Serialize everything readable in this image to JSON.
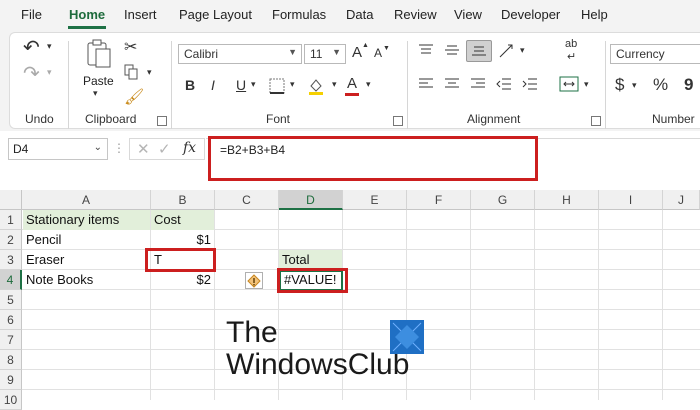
{
  "menu": {
    "items": [
      "File",
      "Home",
      "Insert",
      "Page Layout",
      "Formulas",
      "Data",
      "Review",
      "View",
      "Developer",
      "Help"
    ],
    "active": "Home"
  },
  "ribbon": {
    "groups": {
      "undo": "Undo",
      "clipboard": "Clipboard",
      "font": "Font",
      "alignment": "Alignment",
      "number": "Number"
    },
    "paste_label": "Paste",
    "font_name": "Calibri",
    "font_size": "11",
    "number_format": "Currency",
    "bold": "B",
    "italic": "I",
    "underline": "U",
    "font_color_glyph": "A",
    "currency_glyph": "$",
    "percent_glyph": "%",
    "comma_glyph": "9",
    "grow_font": "A",
    "shrink_font": "A",
    "wrap_text_glyph": "ab",
    "accent_color": "#1e7145"
  },
  "formula_bar": {
    "name_box": "D4",
    "fx": "fx",
    "formula": "=B2+B3+B4"
  },
  "sheet": {
    "columns": [
      "A",
      "B",
      "C",
      "D",
      "E",
      "F",
      "G",
      "H",
      "I",
      "J"
    ],
    "rows": [
      "1",
      "2",
      "3",
      "4",
      "5",
      "6",
      "7",
      "8",
      "9",
      "10"
    ],
    "selected_column": "D",
    "selected_row": "4",
    "cells": {
      "A1": "Stationary  items",
      "B1": "Cost",
      "A2": "Pencil",
      "B2": "$1",
      "A3": "Eraser",
      "B3": "T",
      "D3": "Total",
      "A4": "Note Books",
      "B4": "$2",
      "D4": "#VALUE!"
    },
    "header_fill": "#e2efda",
    "highlight_color": "#cc1f1f"
  },
  "watermark": {
    "line1": "The",
    "line2": "WindowsClub"
  }
}
